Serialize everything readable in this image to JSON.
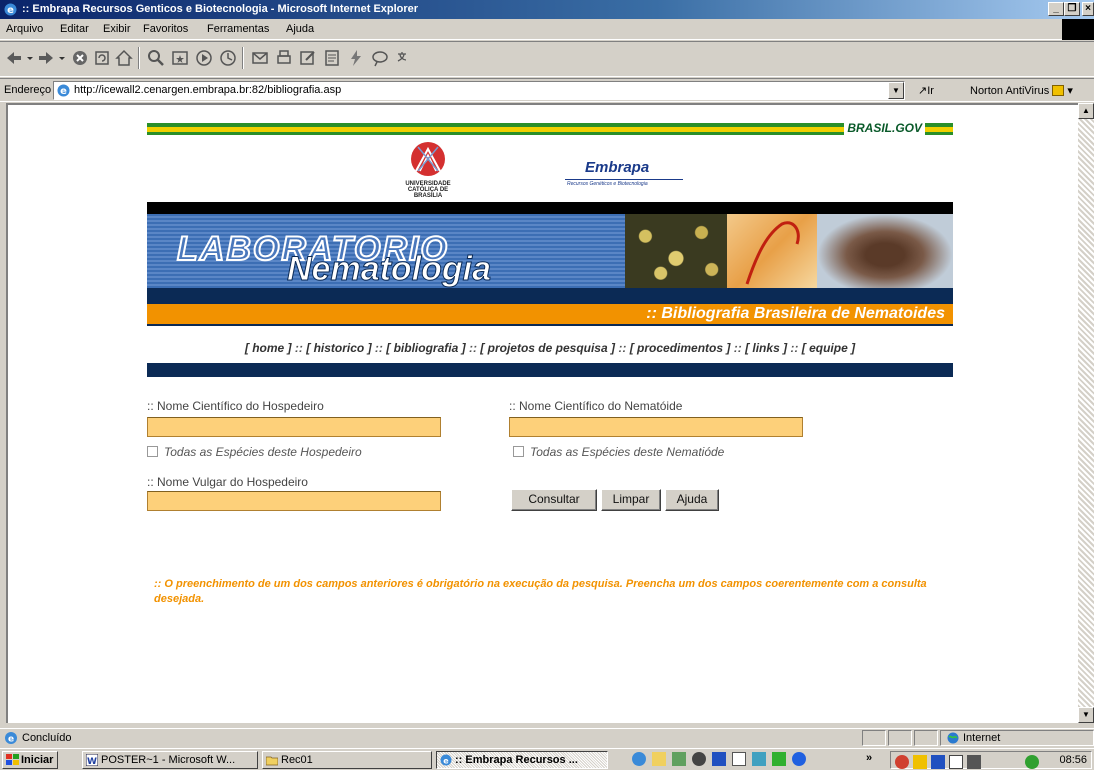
{
  "window": {
    "title": ":: Embrapa Recursos Genticos e Biotecnologia - Microsoft Internet Explorer"
  },
  "menu": [
    "Arquivo",
    "Editar",
    "Exibir",
    "Favoritos",
    "Ferramentas",
    "Ajuda"
  ],
  "address": {
    "label": "Endereço",
    "url": "http://icewall2.cenargen.embrapa.br:82/bibliografia.asp",
    "go": "Ir",
    "norton": "Norton AntiVirus"
  },
  "header": {
    "gov": "BRASIL.GOV",
    "ucb": "UNIVERSIDADE CATÓLICA DE BRASÍLIA",
    "embrapa": "Embrapa",
    "embrapa_sub": "Recursos Genéticos e Biotecnologia",
    "lab": "LABORATORIO",
    "nema": "Nematologia",
    "biblio": ":: Bibliografia Brasileira de Nematoides"
  },
  "nav": {
    "home": "[ home ]",
    "historico": "[ historico ]",
    "bibliografia": "[ bibliografia ]",
    "projetos": "[ projetos de pesquisa ]",
    "procedimentos": "[ procedimentos ]",
    "links": "[ links ]",
    "equipe": "[ equipe ]",
    "sep": "::"
  },
  "form": {
    "host_label": ":: Nome Científico do Hospedeiro",
    "host_value": "",
    "host_all": "Todas as Espécies deste Hospedeiro",
    "nema_label": ":: Nome Científico do Nematóide",
    "nema_value": "",
    "nema_all": "Todas as Espécies deste Nematióde",
    "common_label": ":: Nome Vulgar do Hospedeiro",
    "common_value": "",
    "consultar": "Consultar",
    "limpar": "Limpar",
    "ajuda": "Ajuda"
  },
  "notice": ":: O preenchimento de um dos campos anteriores é obrigatório na execução da pesquisa. Preencha um dos campos coerentemente com a consulta desejada.",
  "status": {
    "text": "Concluído",
    "zone": "Internet"
  },
  "taskbar": {
    "start": "Iniciar",
    "tasks": [
      "POSTER~1 - Microsoft W...",
      "Rec01",
      ":: Embrapa Recursos ..."
    ],
    "clock": "08:56",
    "chevron": "»"
  },
  "colors": {
    "accent_orange": "#f29200",
    "field_fill": "#fdd07a",
    "banner_navy": "#0b2a55",
    "gov_green": "#2a8f2a"
  }
}
